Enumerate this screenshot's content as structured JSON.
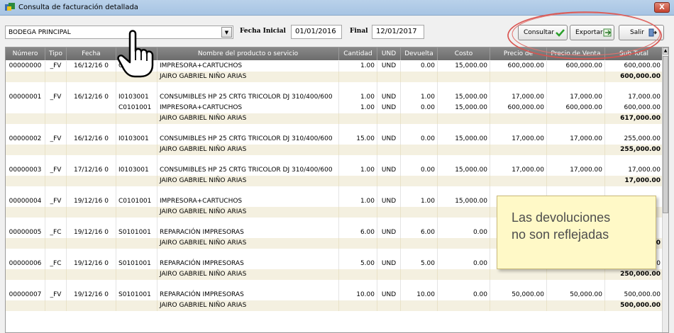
{
  "window": {
    "title": "Consulta de facturación detallada",
    "close": "X"
  },
  "toolbar": {
    "warehouse": "BODEGA PRINCIPAL",
    "fecha_inicial_label": "Fecha Inicial",
    "fecha_inicial": "01/01/2016",
    "final_label": "Final",
    "fecha_final": "12/01/2017",
    "consultar": "Consultar",
    "exportar": "Exportar",
    "salir": "Salir"
  },
  "columns": [
    "Número",
    "Tipo",
    "Fecha",
    "",
    "Nombre del producto o servicio",
    "Cantidad",
    "UND",
    "Devuelta",
    "Costo",
    "Precio de ",
    "Precio de Venta",
    "Sub Total"
  ],
  "rows": [
    {
      "kind": "item",
      "numero": "00000000",
      "tipo": "_FV",
      "fecha": "16/12/16 0",
      "codigo": "C0",
      "nombre": "IMPRESORA+CARTUCHOS",
      "cantidad": "1.00",
      "und": "UND",
      "devuelta": "0.00",
      "costo": "15,000.00",
      "precio": "600,000.00",
      "venta": "600,000.00",
      "subtotal": "600,000.00"
    },
    {
      "kind": "total",
      "nombre": "JAIRO GABRIEL NIÑO ARIAS",
      "subtotal": "600,000.00"
    },
    {
      "kind": "blank"
    },
    {
      "kind": "item",
      "numero": "00000001",
      "tipo": "_FV",
      "fecha": "16/12/16 0",
      "codigo": "I0103001",
      "nombre": "CONSUMIBLES HP 25 CRTG TRICOLOR DJ 310/400/600",
      "cantidad": "1.00",
      "und": "UND",
      "devuelta": "1.00",
      "costo": "15,000.00",
      "precio": "17,000.00",
      "venta": "17,000.00",
      "subtotal": "17,000.00"
    },
    {
      "kind": "item",
      "numero": "",
      "tipo": "",
      "fecha": "",
      "codigo": "C0101001",
      "nombre": "IMPRESORA+CARTUCHOS",
      "cantidad": "1.00",
      "und": "UND",
      "devuelta": "0.00",
      "costo": "15,000.00",
      "precio": "600,000.00",
      "venta": "600,000.00",
      "subtotal": "600,000.00"
    },
    {
      "kind": "total",
      "nombre": "JAIRO GABRIEL NIÑO ARIAS",
      "subtotal": "617,000.00"
    },
    {
      "kind": "blank"
    },
    {
      "kind": "item",
      "numero": "00000002",
      "tipo": "_FV",
      "fecha": "16/12/16 0",
      "codigo": "I0103001",
      "nombre": "CONSUMIBLES HP 25 CRTG TRICOLOR DJ 310/400/600",
      "cantidad": "15.00",
      "und": "UND",
      "devuelta": "0.00",
      "costo": "15,000.00",
      "precio": "17,000.00",
      "venta": "17,000.00",
      "subtotal": "255,000.00"
    },
    {
      "kind": "total",
      "nombre": "JAIRO GABRIEL NIÑO ARIAS",
      "subtotal": "255,000.00"
    },
    {
      "kind": "blank"
    },
    {
      "kind": "item",
      "numero": "00000003",
      "tipo": "_FV",
      "fecha": "17/12/16 0",
      "codigo": "I0103001",
      "nombre": "CONSUMIBLES HP 25 CRTG TRICOLOR DJ 310/400/600",
      "cantidad": "1.00",
      "und": "UND",
      "devuelta": "0.00",
      "costo": "15,000.00",
      "precio": "17,000.00",
      "venta": "17,000.00",
      "subtotal": "17,000.00"
    },
    {
      "kind": "total",
      "nombre": "JAIRO GABRIEL NIÑO ARIAS",
      "subtotal": "17,000.00"
    },
    {
      "kind": "blank"
    },
    {
      "kind": "item",
      "numero": "00000004",
      "tipo": "_FV",
      "fecha": "19/12/16 0",
      "codigo": "C0101001",
      "nombre": "IMPRESORA+CARTUCHOS",
      "cantidad": "1.00",
      "und": "UND",
      "devuelta": "1.00",
      "costo": "15,000.00",
      "precio": "",
      "venta": "",
      "subtotal": ""
    },
    {
      "kind": "total",
      "nombre": "JAIRO GABRIEL NIÑO ARIAS",
      "subtotal": ""
    },
    {
      "kind": "blank"
    },
    {
      "kind": "item",
      "numero": "00000005",
      "tipo": "_FC",
      "fecha": "19/12/16 0",
      "codigo": "S0101001",
      "nombre": "REPARACIÓN IMPRESORAS",
      "cantidad": "6.00",
      "und": "UND",
      "devuelta": "6.00",
      "costo": "0.00",
      "precio": "",
      "venta": "",
      "subtotal": ""
    },
    {
      "kind": "total",
      "nombre": "JAIRO GABRIEL NIÑO ARIAS",
      "subtotal": "0,000.00"
    },
    {
      "kind": "blank"
    },
    {
      "kind": "item",
      "numero": "00000006",
      "tipo": "_FC",
      "fecha": "19/12/16 0",
      "codigo": "S0101001",
      "nombre": "REPARACIÓN IMPRESORAS",
      "cantidad": "5.00",
      "und": "UND",
      "devuelta": "5.00",
      "costo": "0.00",
      "precio": "50,000.00",
      "venta": "50,000.00",
      "subtotal": "250,000.00"
    },
    {
      "kind": "total",
      "nombre": "JAIRO GABRIEL NIÑO ARIAS",
      "subtotal": "250,000.00"
    },
    {
      "kind": "blank"
    },
    {
      "kind": "item",
      "numero": "00000007",
      "tipo": "_FV",
      "fecha": "19/12/16 0",
      "codigo": "S0101001",
      "nombre": "REPARACIÓN IMPRESORAS",
      "cantidad": "10.00",
      "und": "UND",
      "devuelta": "10.00",
      "costo": "0.00",
      "precio": "50,000.00",
      "venta": "50,000.00",
      "subtotal": "500,000.00"
    },
    {
      "kind": "total",
      "nombre": "JAIRO GABRIEL NIÑO ARIAS",
      "subtotal": "500,000.00"
    }
  ],
  "callout": {
    "line1": "Las devoluciones",
    "line2": "no son reflejadas"
  },
  "colors": {
    "header_bg": "#777777",
    "total_row_bg": "#f4f0e0",
    "callout_bg": "#fff9c7",
    "annotation_red": "#d9534f"
  }
}
